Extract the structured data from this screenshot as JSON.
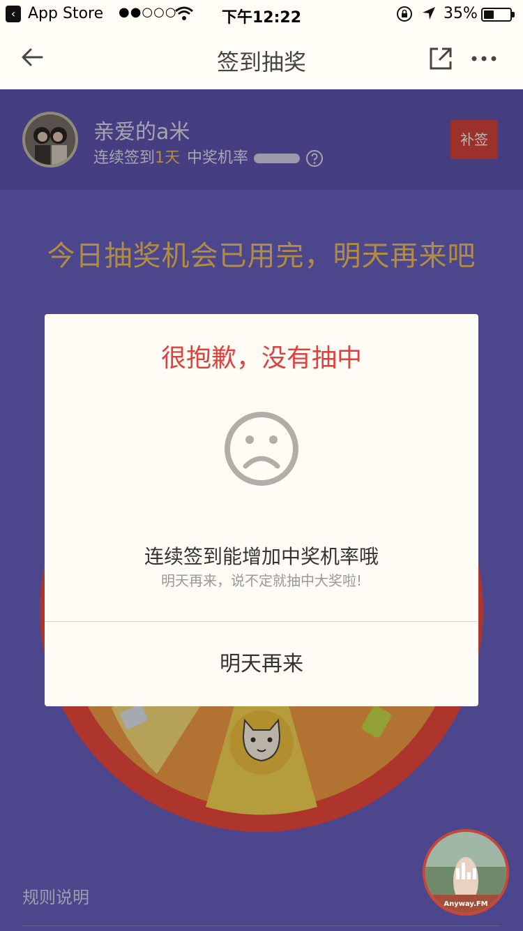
{
  "status_bar": {
    "back_app": "App Store",
    "time": "下午12:22",
    "battery": "35%"
  },
  "nav": {
    "title": "签到抽奖"
  },
  "profile": {
    "name": "亲爱的a米",
    "signin_prefix": "连续签到",
    "signin_days": "1天",
    "rate_label": "中奖机率",
    "makeup_button": "补签"
  },
  "notice": "今日抽奖机会已用完，明天再来吧",
  "dialog": {
    "title": "很抱歉，没有抽中",
    "message": "连续签到能增加中奖机率哦",
    "sub_message": "明天再来，说不定就抽中大奖啦!",
    "button": "明天再来"
  },
  "rules_label": "规则说明",
  "floating_badge": "Anyway.FM",
  "colors": {
    "accent_red": "#e0413c",
    "brand_gold": "#f6c35b",
    "purple_bg": "#6a63c4"
  }
}
